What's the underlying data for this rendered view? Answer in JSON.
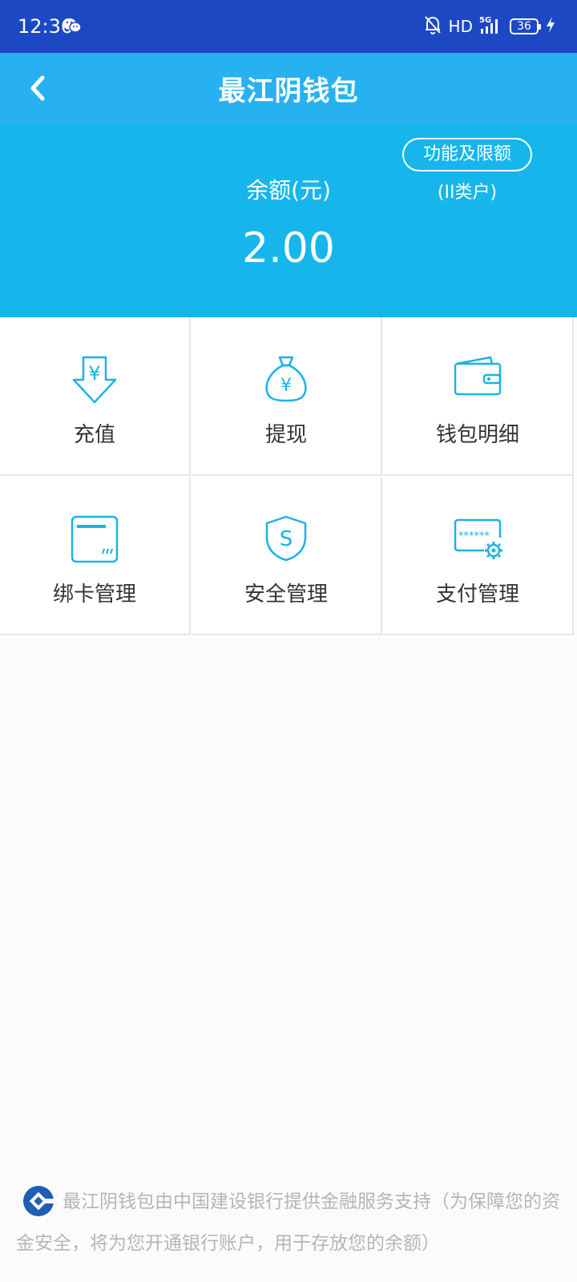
{
  "status_bar": {
    "time": "12:36",
    "network": "HD",
    "battery": "36",
    "icons": [
      "wechat-icon",
      "bell-off-icon",
      "signal-5g-icon",
      "battery-icon",
      "charging-icon"
    ]
  },
  "nav": {
    "title": "最江阴钱包",
    "back_icon": "chevron-left-icon"
  },
  "balance": {
    "label": "余额(元)",
    "value": "2.00",
    "limits_button": "功能及限额",
    "account_type": "(II类户)"
  },
  "menu": [
    {
      "label": "充值",
      "icon": "deposit-icon"
    },
    {
      "label": "提现",
      "icon": "money-bag-icon"
    },
    {
      "label": "钱包明细",
      "icon": "wallet-icon"
    },
    {
      "label": "绑卡管理",
      "icon": "bank-card-icon"
    },
    {
      "label": "安全管理",
      "icon": "shield-icon"
    },
    {
      "label": "支付管理",
      "icon": "payment-settings-icon"
    }
  ],
  "footer": {
    "text": "最江阴钱包由中国建设银行提供金融服务支持（为保障您的资金安全，将为您开通银行账户，用于存放您的余额）"
  },
  "colors": {
    "status_bar": "#1d48c4",
    "nav_bar": "#27b1f1",
    "balance_panel": "#16b6ec",
    "icon_accent": "#1ab3e6"
  }
}
